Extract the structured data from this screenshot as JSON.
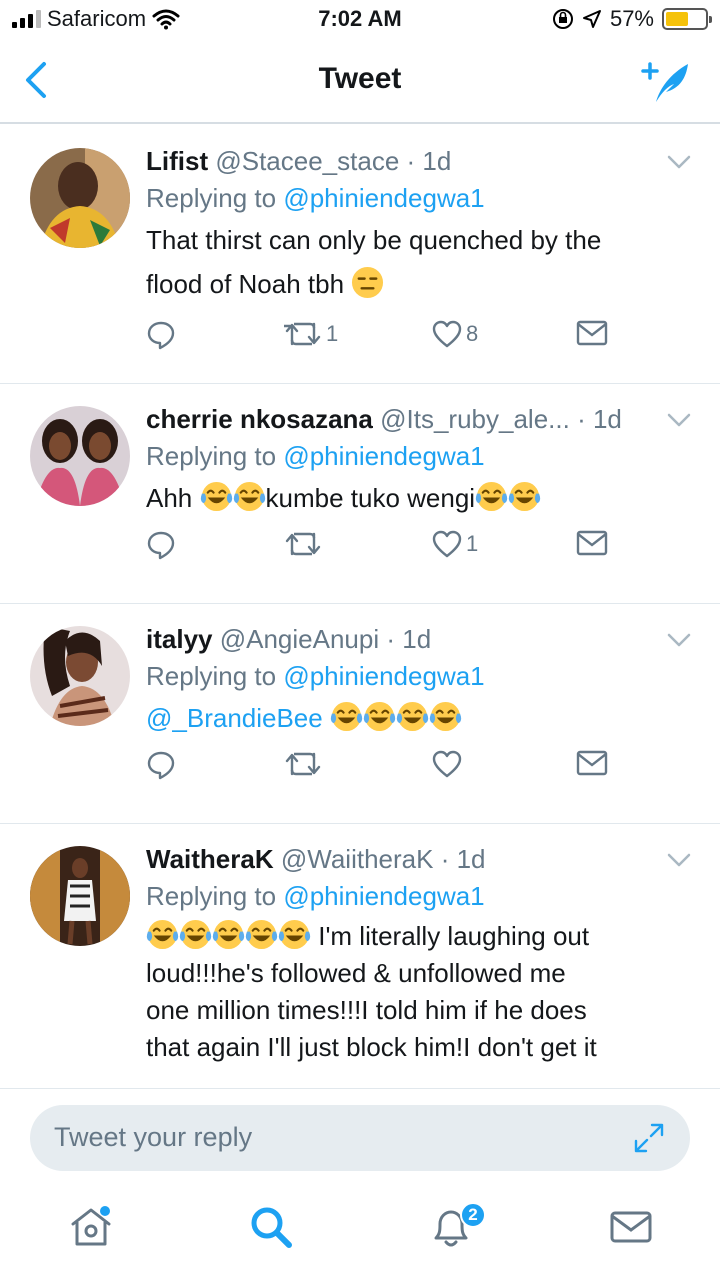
{
  "status_bar": {
    "carrier": "Safaricom",
    "time": "7:02 AM",
    "battery_percent": "57%",
    "battery_level": 0.57
  },
  "nav": {
    "title": "Tweet"
  },
  "tweets": [
    {
      "name": "Lifist",
      "handle": "@Stacee_stace",
      "time": "1d",
      "replying_label": "Replying to",
      "replying_handle": "@phiniendegwa1",
      "text_line1": "That thirst can only be quenched by the",
      "text_line2": "flood of Noah tbh",
      "emoji": "expressionless-face",
      "retweets": "1",
      "likes": "8"
    },
    {
      "name": "cherrie nkosazana",
      "handle": "@Its_ruby_ale...",
      "time": "1d",
      "replying_label": "Replying to",
      "replying_handle": "@phiniendegwa1",
      "text_part1": "Ahh ",
      "text_part2": "kumbe tuko wengi",
      "emoji": "tears-of-joy",
      "retweets": "",
      "likes": "1"
    },
    {
      "name": "italyy",
      "handle": "@AngieAnupi",
      "time": "1d",
      "replying_label": "Replying to",
      "replying_handle": "@phiniendegwa1",
      "mention": "@_BrandieBee",
      "emoji": "tears-of-joy",
      "retweets": "",
      "likes": ""
    },
    {
      "name": "WaitheraK",
      "handle": "@WaiitheraK",
      "time": "1d",
      "replying_label": "Replying to",
      "replying_handle": "@phiniendegwa1",
      "text_line1": " I'm literally laughing out",
      "text_line2": "loud!!!he's followed & unfollowed me",
      "text_line3": "one million times!!!I told him if he does",
      "text_line4": "that again I'll just block him!I don't get it",
      "emoji": "tears-of-joy"
    }
  ],
  "reply_bar": {
    "placeholder": "Tweet your reply"
  },
  "tab_bar": {
    "notifications_count": "2",
    "items": [
      "home-icon",
      "search-icon",
      "notifications-icon",
      "messages-icon"
    ]
  },
  "colors": {
    "accent": "#1da1f2",
    "muted": "#657786",
    "text": "#14171a"
  }
}
